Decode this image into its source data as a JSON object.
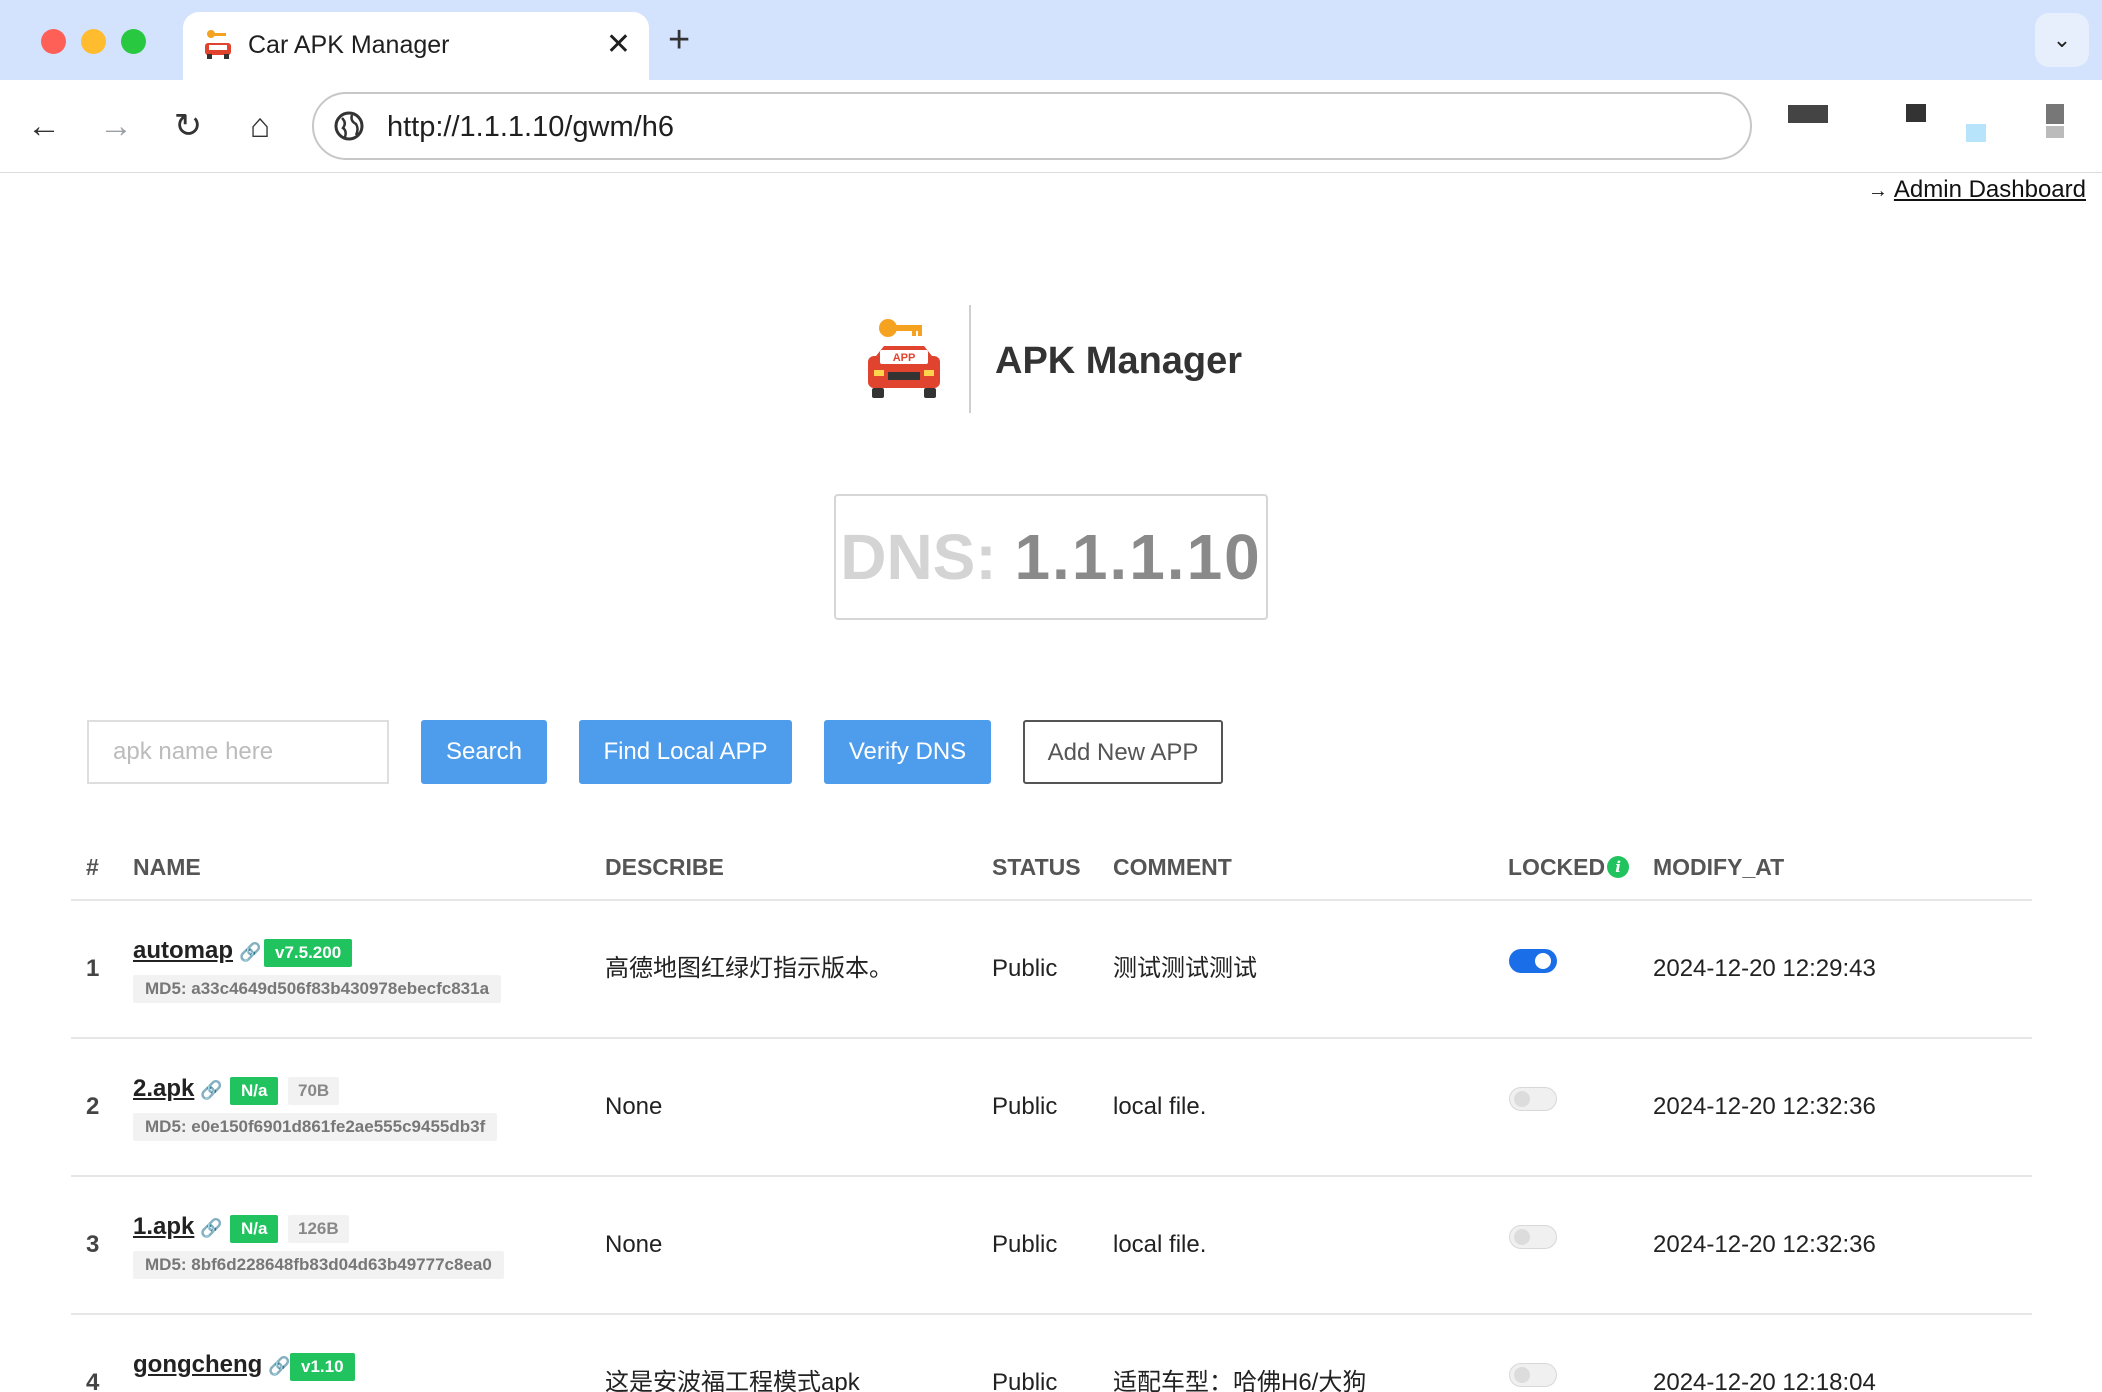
{
  "browser": {
    "tab_title": "Car APK Manager",
    "tab_close": "✕",
    "new_tab": "+",
    "tab_menu": "⌄",
    "url": "http://1.1.1.10/gwm/h6",
    "nav": {
      "back": "←",
      "forward": "→",
      "reload": "↻",
      "home": "⌂"
    }
  },
  "header": {
    "admin_link": "Admin Dashboard",
    "admin_arrow": "→",
    "brand_title": "APK Manager",
    "logo_badge": "APP"
  },
  "dns": {
    "label": "DNS:",
    "value": "1.1.1.10"
  },
  "search": {
    "placeholder": "apk name here",
    "search_label": "Search",
    "find_local_label": "Find Local APP",
    "verify_dns_label": "Verify DNS",
    "add_new_label": "Add New APP"
  },
  "table": {
    "columns": {
      "index": "#",
      "name": "NAME",
      "describe": "DESCRIBE",
      "status": "STATUS",
      "comment": "COMMENT",
      "locked": "LOCKED",
      "locked_info": "i",
      "modify_at": "MODIFY_AT"
    },
    "rows": [
      {
        "index": "1",
        "name": "automap",
        "version": "v7.5.200",
        "size": "",
        "md5": "MD5: a33c4649d506f83b430978ebecfc831a",
        "describe": "高德地图红绿灯指示版本。",
        "status": "Public",
        "comment": "测试测试测试",
        "locked": true,
        "modify_at": "2024-12-20 12:29:43"
      },
      {
        "index": "2",
        "name": "2.apk",
        "version": "N/a",
        "size": "70B",
        "md5": "MD5: e0e150f6901d861fe2ae555c9455db3f",
        "describe": "None",
        "status": "Public",
        "comment": "local file.",
        "locked": false,
        "modify_at": "2024-12-20 12:32:36"
      },
      {
        "index": "3",
        "name": "1.apk",
        "version": "N/a",
        "size": "126B",
        "md5": "MD5: 8bf6d228648fb83d04d63b49777c8ea0",
        "describe": "None",
        "status": "Public",
        "comment": "local file.",
        "locked": false,
        "modify_at": "2024-12-20 12:32:36"
      },
      {
        "index": "4",
        "name": "gongcheng",
        "version": "v1.10",
        "size": "",
        "md5": "",
        "describe": "这是安波福工程模式apk",
        "status": "Public",
        "comment": "适配车型：哈佛H6/大狗",
        "locked": false,
        "modify_at": "2024-12-20 12:18:04"
      }
    ]
  },
  "colors": {
    "primary_button": "#4e9dec",
    "version_badge": "#20c35e",
    "toggle_on": "#1a6fe8",
    "tab_strip": "#d3e3fd"
  },
  "icons": {
    "link": "🔗",
    "tab_favicon": "car-key-icon",
    "omnibox": "globe-icon"
  }
}
